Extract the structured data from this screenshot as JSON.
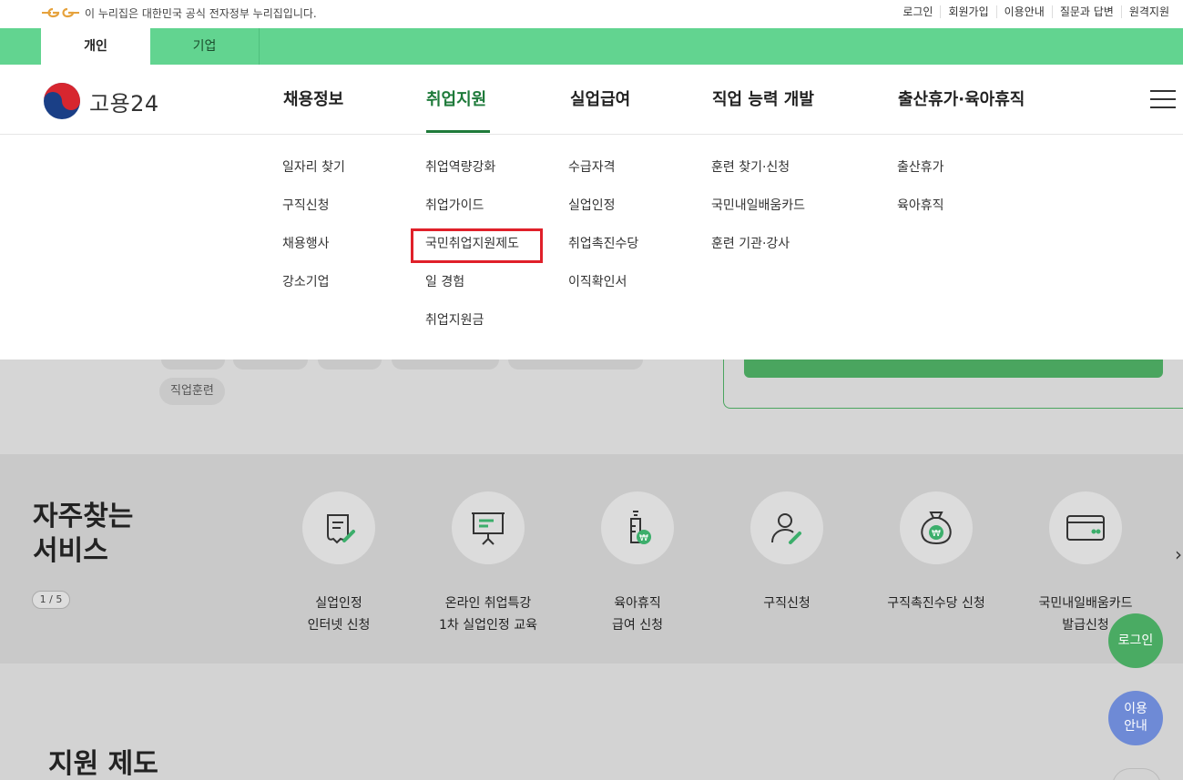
{
  "topbar": {
    "gov_notice": "이 누리집은 대한민국 공식 전자정부 누리집입니다.",
    "links": [
      "로그인",
      "회원가입",
      "이용안내",
      "질문과 답변",
      "원격지원"
    ]
  },
  "tabs": [
    "개인",
    "기업"
  ],
  "brand": {
    "name": "고용24"
  },
  "gnb": [
    "채용정보",
    "취업지원",
    "실업급여",
    "직업 능력 개발",
    "출산휴가·육아휴직"
  ],
  "mega_menu": [
    [
      "일자리 찾기",
      "구직신청",
      "채용행사",
      "강소기업"
    ],
    [
      "취업역량강화",
      "취업가이드",
      "국민취업지원제도",
      "일 경험",
      "취업지원금"
    ],
    [
      "수급자격",
      "실업인정",
      "취업촉진수당",
      "이직확인서"
    ],
    [
      "훈련 찾기·신청",
      "국민내일배움카드",
      "훈련 기관·강사"
    ],
    [
      "출산휴가",
      "육아휴직"
    ]
  ],
  "background": {
    "tag": "직업훈련",
    "freq_title_line1": "자주찾는",
    "freq_title_line2": "서비스",
    "pager": "1 / 5",
    "services": [
      {
        "line1": "실업인정",
        "line2": "인터넷 신청",
        "icon": "document-pen-icon"
      },
      {
        "line1": "온라인 취업특강",
        "line2": "1차 실업인정 교육",
        "icon": "presentation-board-icon"
      },
      {
        "line1": "육아휴직",
        "line2": "급여 신청",
        "icon": "baby-bottle-won-icon"
      },
      {
        "line1": "구직신청",
        "line2": "",
        "icon": "person-pen-icon"
      },
      {
        "line1": "구직촉진수당 신청",
        "line2": "",
        "icon": "money-bag-icon"
      },
      {
        "line1": "국민내일배움카드",
        "line2": "발급신청",
        "icon": "card-icon"
      }
    ],
    "support_title": "지원 제도"
  },
  "fab": {
    "login": "로그인",
    "guide_line1": "이용",
    "guide_line2": "안내"
  },
  "colors": {
    "accent_green": "#62d490",
    "active_text": "#1e7a3a",
    "highlight": "#e0202a"
  }
}
